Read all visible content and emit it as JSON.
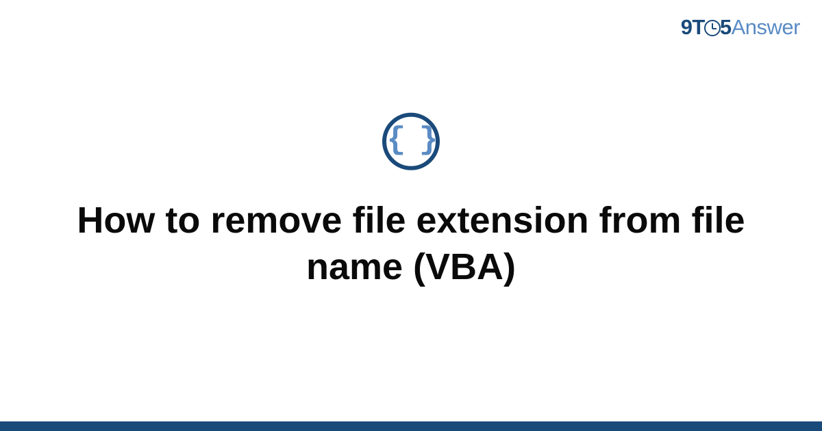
{
  "brand": {
    "part1": "9T",
    "part2": "5",
    "part3": "Answer"
  },
  "icon": {
    "left_brace": "{",
    "right_brace": "}"
  },
  "page": {
    "title": "How to remove file extension from file name (VBA)"
  },
  "colors": {
    "primary": "#1a4a7a",
    "secondary": "#5a8bc4"
  }
}
